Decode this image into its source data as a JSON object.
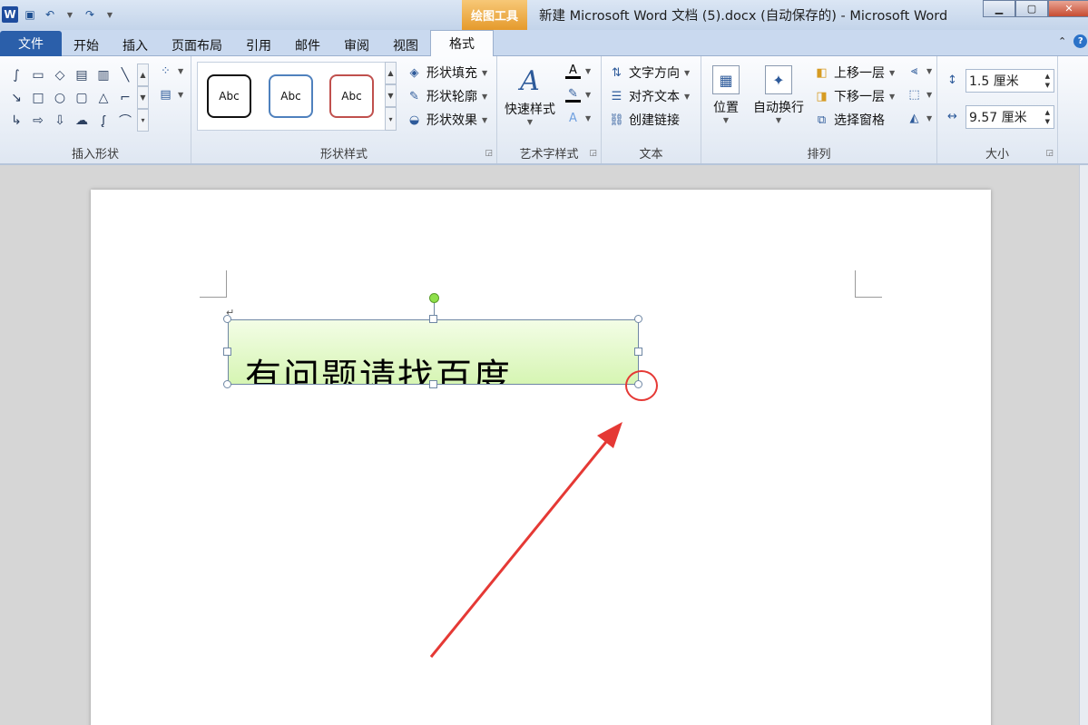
{
  "app": {
    "window_title": "新建 Microsoft Word 文档 (5).docx (自动保存的) - Microsoft Word",
    "context_tab_group": "绘图工具",
    "logo": "W"
  },
  "tabs": [
    {
      "label": "文件"
    },
    {
      "label": "开始"
    },
    {
      "label": "插入"
    },
    {
      "label": "页面布局"
    },
    {
      "label": "引用"
    },
    {
      "label": "邮件"
    },
    {
      "label": "审阅"
    },
    {
      "label": "视图"
    },
    {
      "label": "格式",
      "active": true
    }
  ],
  "groups": {
    "insert_shapes": {
      "title": "插入形状"
    },
    "shape_styles": {
      "title": "形状样式",
      "style_label": "Abc",
      "fill": "形状填充",
      "outline": "形状轮廓",
      "effects": "形状效果"
    },
    "wordart": {
      "title": "艺术字样式",
      "quick_styles": "快速样式"
    },
    "text": {
      "title": "文本",
      "direction": "文字方向",
      "align": "对齐文本",
      "link": "创建链接"
    },
    "arrange": {
      "title": "排列",
      "position": "位置",
      "wrap": "自动换行",
      "bring_forward": "上移一层",
      "send_backward": "下移一层",
      "selection_pane": "选择窗格"
    },
    "size": {
      "title": "大小",
      "height": "1.5 厘米",
      "width": "9.57 厘米"
    }
  },
  "document": {
    "textbox_text": "有问题请找百度",
    "paragraph_mark": "↵"
  },
  "colors": {
    "accent": "#2b5faa",
    "context_tab": "#e59a2c",
    "annotation": "#e53935",
    "textbox_fill": "#d6f5b3"
  }
}
